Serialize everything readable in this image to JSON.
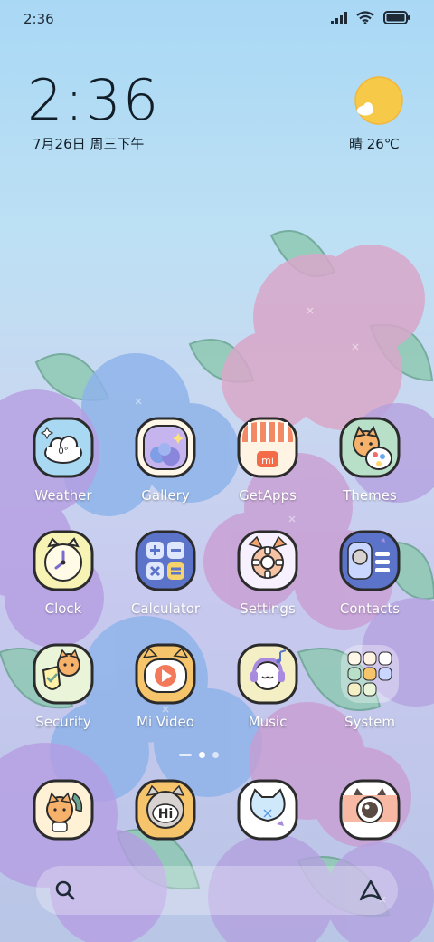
{
  "status_bar": {
    "time": "2:36",
    "icons": [
      "signal-icon",
      "wifi-icon",
      "battery-icon"
    ]
  },
  "clock_widget": {
    "time": "2:36",
    "date": "7月26日 周三下午"
  },
  "weather_widget": {
    "icon": "sun-cloud-icon",
    "text": "晴 26℃"
  },
  "apps": [
    {
      "label": "Weather",
      "icon": "weather-icon"
    },
    {
      "label": "Gallery",
      "icon": "gallery-icon"
    },
    {
      "label": "GetApps",
      "icon": "getapps-icon"
    },
    {
      "label": "Themes",
      "icon": "themes-icon"
    },
    {
      "label": "Clock",
      "icon": "clock-icon"
    },
    {
      "label": "Calculator",
      "icon": "calculator-icon"
    },
    {
      "label": "Settings",
      "icon": "settings-icon"
    },
    {
      "label": "Contacts",
      "icon": "contacts-icon"
    },
    {
      "label": "Security",
      "icon": "security-icon"
    },
    {
      "label": "Mi Video",
      "icon": "mi-video-icon"
    },
    {
      "label": "Music",
      "icon": "music-icon"
    },
    {
      "label": "System",
      "icon": "system-folder-icon"
    }
  ],
  "weather_icon_text": "0°",
  "getapps_logo_text": "mi",
  "messages_icon_text": "Hi",
  "page_indicator": {
    "pages": 2,
    "current": 1
  },
  "dock": [
    {
      "icon": "phone-icon"
    },
    {
      "icon": "messages-icon"
    },
    {
      "icon": "browser-icon"
    },
    {
      "icon": "camera-icon"
    }
  ],
  "search_bar": {
    "left_icon": "search-icon",
    "right_icon": "assistant-icon"
  },
  "colors": {
    "sky_top": "#a9d8f5",
    "icon_outline": "#2b2b2b",
    "label": "#ffffff",
    "sun": "#f7c948"
  }
}
